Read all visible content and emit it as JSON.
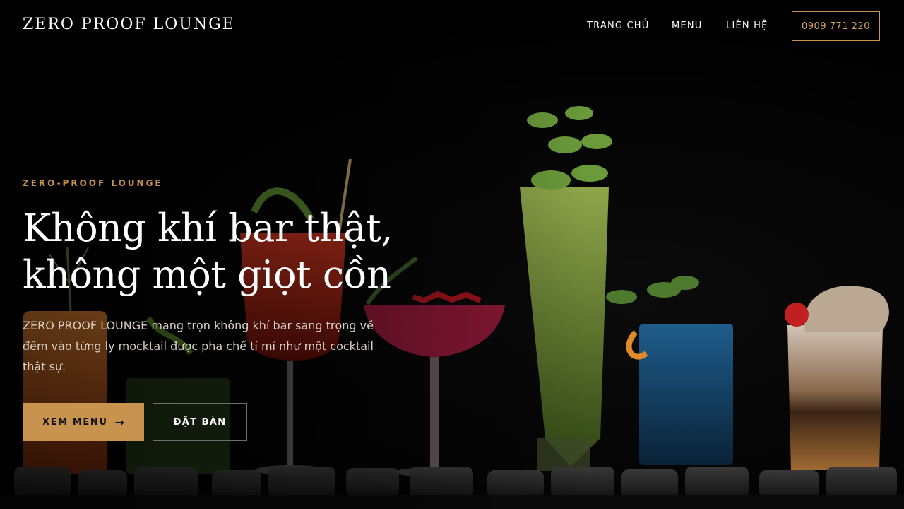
{
  "nav": {
    "brand": "ZERO PROOF LOUNGE",
    "links": [
      "TRANG CHỦ",
      "MENU",
      "LIÊN HỆ"
    ],
    "phone": "0909 771 220"
  },
  "hero": {
    "eyebrow": "ZERO-PROOF LOUNGE",
    "headline": "Không khí bar thật, không một giọt cồn",
    "lead": "ZERO PROOF LOUNGE mang trọn không khí bar sang trọng về đêm vào từng ly mocktail được pha chế tỉ mỉ như một cocktail thật sự.",
    "primary_cta": "XEM MENU",
    "primary_cta_icon": "arrow-right-icon",
    "secondary_cta": "ĐẶT BÀN"
  },
  "colors": {
    "accent": "#c8924f",
    "background": "#000000",
    "text": "#ffffff"
  }
}
